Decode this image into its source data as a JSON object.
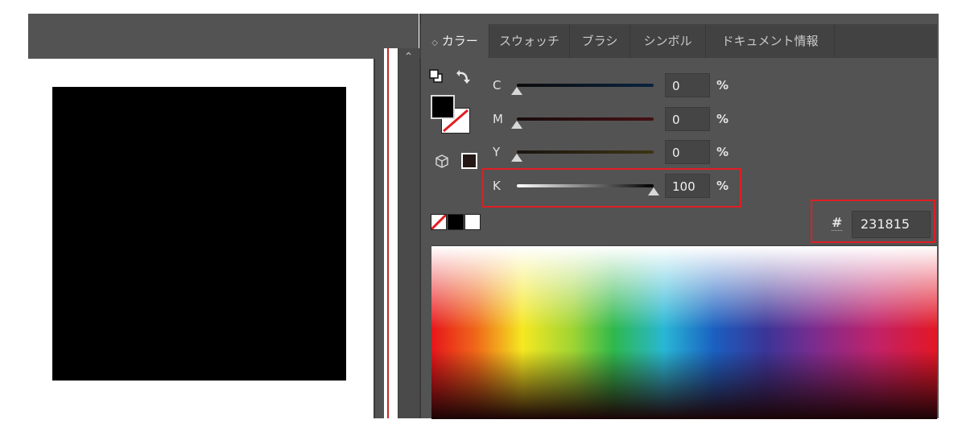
{
  "tabs": [
    {
      "label": "カラー",
      "prefix": "◇",
      "active": true
    },
    {
      "label": "スウォッチ"
    },
    {
      "label": "ブラシ"
    },
    {
      "label": "シンボル"
    },
    {
      "label": "ドキュメント情報"
    }
  ],
  "sliders": [
    {
      "label": "C",
      "value": "0",
      "unit": "%",
      "level": 0
    },
    {
      "label": "M",
      "value": "0",
      "unit": "%",
      "level": 0
    },
    {
      "label": "Y",
      "value": "0",
      "unit": "%",
      "level": 0
    },
    {
      "label": "K",
      "value": "100",
      "unit": "%",
      "level": 100
    }
  ],
  "hex": {
    "symbol": "#",
    "value": "231815"
  },
  "colors": {
    "fill": "#000000",
    "cmyk_preview": "#231815",
    "highlight": "#e01e24",
    "guide": "#c8282a"
  },
  "icons": [
    "swap-fill-stroke-icon",
    "default-colors-icon",
    "fill-swatch-icon",
    "stroke-none-icon",
    "gamut-cube-icon",
    "none-swatch-icon",
    "black-swatch-icon",
    "white-swatch-icon",
    "scroll-up-icon"
  ]
}
